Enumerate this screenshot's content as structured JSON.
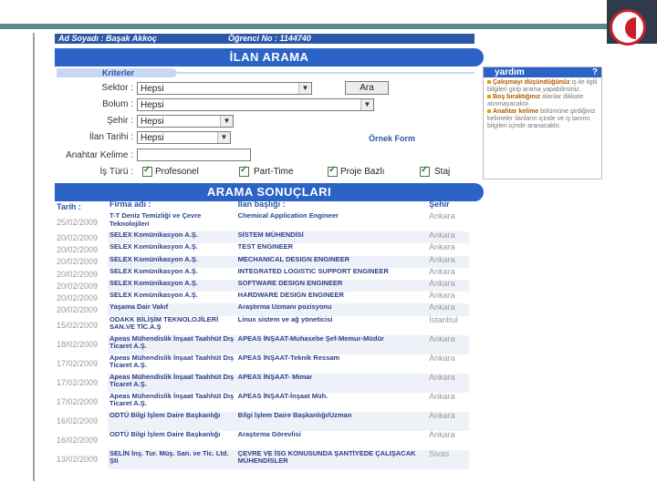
{
  "header": {
    "user_label": "Ad Soyadı : Başak Akkoç",
    "student_label": "Öğrenci No : 1144740"
  },
  "search": {
    "title": "İLAN ARAMA",
    "criteria_tab": "Kriterler",
    "fields": {
      "sektor_label": "Sektor :",
      "sektor_value": "Hepsi",
      "bolum_label": "Bolum :",
      "bolum_value": "Hepsi",
      "sehir_label": "Şehir :",
      "sehir_value": "Hepsi",
      "tarih_label": "İlan Tarihi :",
      "tarih_value": "Hepsi",
      "anahtar_label": "Anahtar Kelime :",
      "anahtar_value": "",
      "is_turu_label": "İş Türü :"
    },
    "search_button": "Ara",
    "example_link": "Örnek Form",
    "job_types": [
      "Profesonel",
      "Part-Time",
      "Proje Bazlı",
      "Staj"
    ]
  },
  "help": {
    "title": "yardım",
    "question_mark": "?",
    "items": [
      {
        "lead": "Çalışmayı düşündüğünüz",
        "text": "iş ile ilgili bilgileri girip arama yapabilirsiniz."
      },
      {
        "lead": "Boş bıraktığınız",
        "text": "alanlar dikkate alınmayacaktır."
      },
      {
        "lead": "Anahtar kelime",
        "text": "bölümüne girdiğiniz kelimeler ilanların içinde ve iş tanımı bilgileri içinde aranacaktır."
      }
    ]
  },
  "results": {
    "title": "ARAMA SONUÇLARI",
    "columns": [
      "Tarih :",
      "Firma adı :",
      "İlan başlığı :",
      "Şehir"
    ],
    "rows": [
      {
        "date": "25/02/2009",
        "company": "T-T Deniz Temizliği ve Çevre Teknolojileri",
        "title": "Chemical Application Engineer",
        "city": "Ankara"
      },
      {
        "date": "20/02/2009",
        "company": "SELEX Komünikasyon A.Ş.",
        "title": "SİSTEM MÜHENDİSİ",
        "city": "Ankara"
      },
      {
        "date": "20/02/2009",
        "company": "SELEX Komünikasyon A.Ş.",
        "title": "TEST ENGINEER",
        "city": "Ankara"
      },
      {
        "date": "20/02/2009",
        "company": "SELEX Komünikasyon A.Ş.",
        "title": "MECHANICAL DESIGN ENGINEER",
        "city": "Ankara"
      },
      {
        "date": "20/02/2009",
        "company": "SELEX Komünikasyon A.Ş.",
        "title": "INTEGRATED LOGISTIC SUPPORT ENGINEER",
        "city": "Ankara"
      },
      {
        "date": "20/02/2009",
        "company": "SELEX Komünikasyon A.Ş.",
        "title": "SOFTWARE DESIGN ENGINEER",
        "city": "Ankara"
      },
      {
        "date": "20/02/2009",
        "company": "SELEX Komünikasyon A.Ş.",
        "title": "HARDWARE DESIGN ENGINEER",
        "city": "Ankara"
      },
      {
        "date": "20/02/2009",
        "company": "Yaşama Dair Vakıf",
        "title": "Araştırma Uzmanı pozisyonu",
        "city": "Ankara"
      },
      {
        "date": "15/02/2009",
        "company": "ODAKK BİLİŞİM TEKNOLOJİLERİ SAN.VE TİC.A.Ş",
        "title": "Linux sistem ve ağ yöneticisi",
        "city": "İstanbul"
      },
      {
        "date": "18/02/2009",
        "company": "Apeas Mühendislik İnşaat Taahhüt Dış Ticaret A.Ş.",
        "title": "APEAS İNŞAAT-Muhasebe Şef-Memur-Müdür",
        "city": "Ankara"
      },
      {
        "date": "17/02/2009",
        "company": "Apeas Mühendislik İnşaat Taahhüt Dış Ticaret A.Ş.",
        "title": "APEAS İNŞAAT-Teknik Ressam",
        "city": "Ankara"
      },
      {
        "date": "17/02/2009",
        "company": "Apeas Mühendislik İnşaat Taahhüt Dış Ticaret A.Ş.",
        "title": "APEAS İNŞAAT- Mimar",
        "city": "Ankara"
      },
      {
        "date": "17/02/2009",
        "company": "Apeas Mühendislik İnşaat Taahhüt Dış Ticaret A.Ş.",
        "title": "APEAS İNŞAAT-İnşaat Müh.",
        "city": "Ankara"
      },
      {
        "date": "16/02/2009",
        "company": "ODTÜ Bilgi İşlem Daire Başkanlığı",
        "title": "Bilgi İşlem Daire Başkanlığı/Uzman",
        "city": "Ankara"
      },
      {
        "date": "16/02/2009",
        "company": "ODTÜ Bilgi İşlem Daire Başkanlığı",
        "title": "Araştırma Görevlisi",
        "city": "Ankara"
      },
      {
        "date": "13/02/2009",
        "company": "SELİN İnş. Tur. Müş. San. ve Tic. Ltd. Şti",
        "title": "ÇEVRE VE İSG KONUSUNDA ŞANTİYEDE ÇALIŞACAK MÜHENDİSLER",
        "city": "Sivas"
      }
    ]
  }
}
